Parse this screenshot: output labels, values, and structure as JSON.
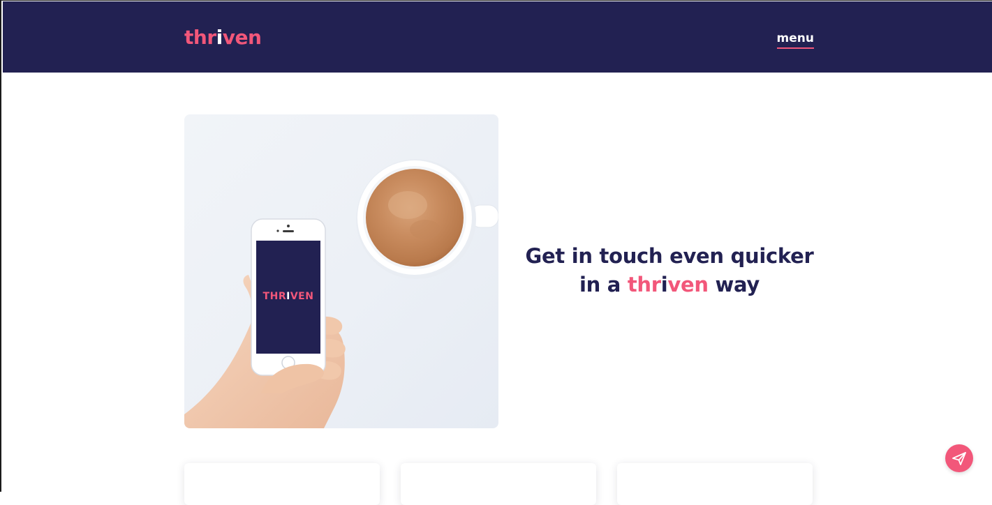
{
  "header": {
    "logo": {
      "part1": "thr",
      "part2": "i",
      "part3": "ven"
    },
    "menu_label": "menu"
  },
  "hero": {
    "image_brand": {
      "part1": "THR",
      "part2": "I",
      "part3": "VEN"
    },
    "line1": "Get in touch even quicker",
    "line2_prefix": "in a ",
    "line2_brand": {
      "part1": "thr",
      "part2": "i",
      "part3": "ven"
    },
    "line2_suffix": " way"
  },
  "fab": {
    "icon": "send-icon"
  },
  "colors": {
    "navy": "#222152",
    "pink": "#f2577a",
    "white": "#ffffff"
  }
}
